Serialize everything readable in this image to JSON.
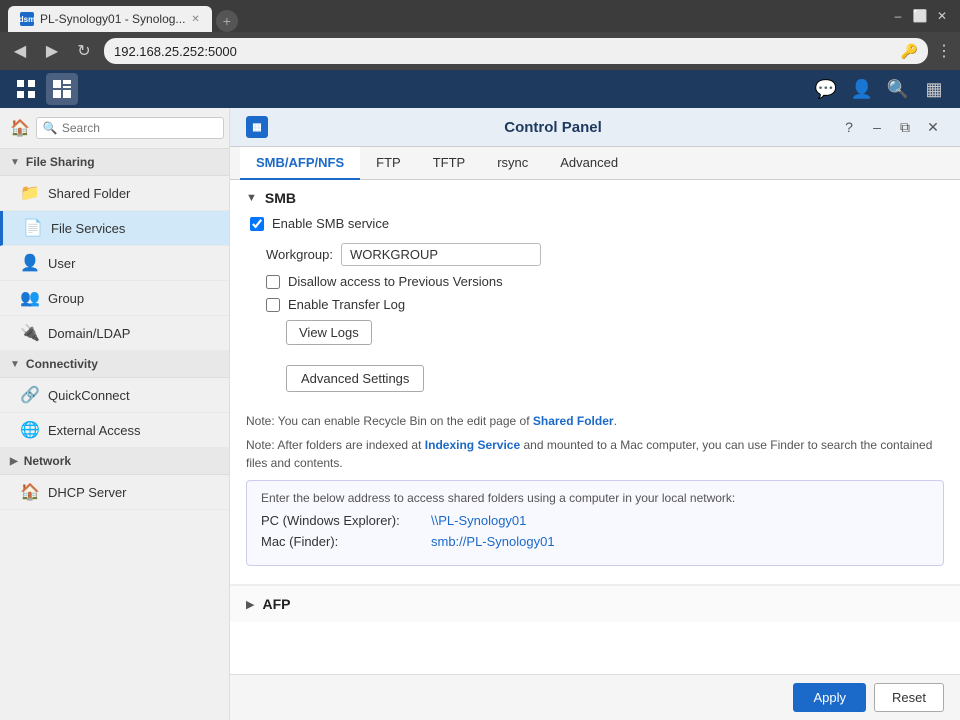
{
  "browser": {
    "tab_label": "PL-Synology01 - Synolog...",
    "address": "192.168.25.252:5000",
    "nav_back": "◀",
    "nav_forward": "▶",
    "nav_refresh": "↻"
  },
  "app_toolbar": {
    "app_grid_label": "⊞",
    "app_control_panel_label": "▦"
  },
  "panel": {
    "title": "Control Panel",
    "min_label": "–",
    "restore_label": "⧉",
    "close_label": "✕"
  },
  "tabs": [
    {
      "id": "smb-afp-nfs",
      "label": "SMB/AFP/NFS",
      "active": true
    },
    {
      "id": "ftp",
      "label": "FTP",
      "active": false
    },
    {
      "id": "tftp",
      "label": "TFTP",
      "active": false
    },
    {
      "id": "rsync",
      "label": "rsync",
      "active": false
    },
    {
      "id": "advanced",
      "label": "Advanced",
      "active": false
    }
  ],
  "sidebar": {
    "search_placeholder": "Search",
    "sections": [
      {
        "id": "file-sharing",
        "label": "File Sharing",
        "expanded": true,
        "items": [
          {
            "id": "shared-folder",
            "label": "Shared Folder",
            "icon": "📁",
            "active": false
          },
          {
            "id": "file-services",
            "label": "File Services",
            "icon": "📄",
            "active": true
          }
        ]
      },
      {
        "id": "user-group",
        "label": "",
        "items": [
          {
            "id": "user",
            "label": "User",
            "icon": "👤",
            "active": false
          },
          {
            "id": "group",
            "label": "Group",
            "icon": "👥",
            "active": false
          },
          {
            "id": "domain-ldap",
            "label": "Domain/LDAP",
            "icon": "🔌",
            "active": false
          }
        ]
      },
      {
        "id": "connectivity",
        "label": "Connectivity",
        "expanded": true,
        "items": [
          {
            "id": "quickconnect",
            "label": "QuickConnect",
            "icon": "🔗",
            "active": false
          },
          {
            "id": "external-access",
            "label": "External Access",
            "icon": "🌐",
            "active": false
          }
        ]
      },
      {
        "id": "network",
        "label": "Network",
        "expanded": false,
        "items": [
          {
            "id": "dhcp-server",
            "label": "DHCP Server",
            "icon": "🏠",
            "active": false
          }
        ]
      }
    ]
  },
  "smb": {
    "section_title": "SMB",
    "enable_label": "Enable SMB service",
    "enable_checked": true,
    "workgroup_label": "Workgroup:",
    "workgroup_value": "WORKGROUP",
    "disallow_prev_label": "Disallow access to Previous Versions",
    "disallow_prev_checked": false,
    "transfer_log_label": "Enable Transfer Log",
    "transfer_log_checked": false,
    "view_logs_btn": "View Logs",
    "advanced_settings_btn": "Advanced Settings",
    "note1": "Note: You can enable Recycle Bin on the edit page of ",
    "note1_link": "Shared Folder",
    "note1_end": ".",
    "note2": "Note: After folders are indexed at ",
    "note2_link": "Indexing Service",
    "note2_end": " and mounted to a Mac computer, you can use Finder to search the contained files and contents.",
    "network_box_title": "Enter the below address to access shared folders using a computer in your local network:",
    "pc_label": "PC (Windows Explorer):",
    "pc_link": "\\\\PL-Synology01",
    "mac_label": "Mac (Finder):",
    "mac_link": "smb://PL-Synology01"
  },
  "afp": {
    "section_title": "AFP"
  },
  "footer": {
    "apply_btn": "Apply",
    "reset_btn": "Reset"
  }
}
